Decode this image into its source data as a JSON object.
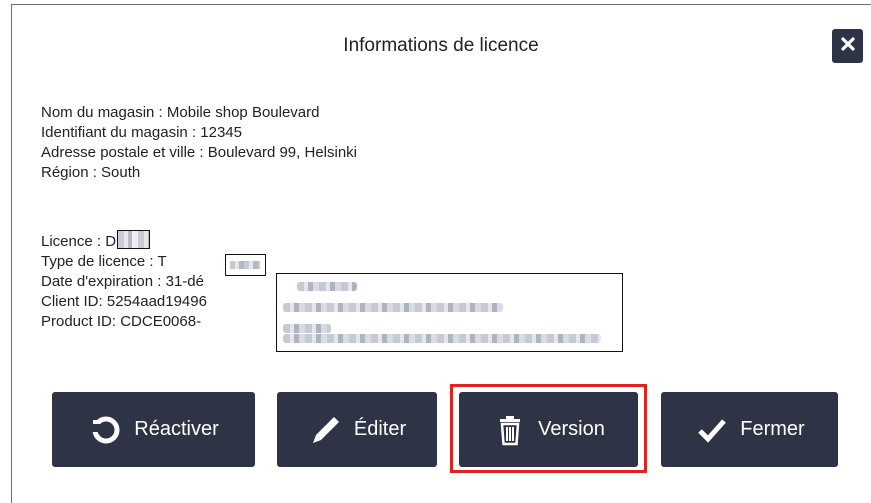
{
  "dialog": {
    "title": "Informations de licence",
    "close_icon": "close-icon"
  },
  "store": {
    "name_line": "Nom du magasin : Mobile shop Boulevard",
    "id_line": "Identifiant du magasin : 12345",
    "address_line": "Adresse postale et ville : Boulevard 99, Helsinki",
    "region_line": "Région : South"
  },
  "license": {
    "licence_line": "Licence : D",
    "type_line": "Type de licence : T",
    "expiration_line": "Date d'expiration : 31-dé",
    "client_id_line": "Client ID: 5254aad19496",
    "product_id_line": "Product ID: CDCE0068-"
  },
  "buttons": {
    "reactivate": {
      "label": "Réactiver",
      "icon": "refresh-icon"
    },
    "edit": {
      "label": "Éditer",
      "icon": "pencil-icon"
    },
    "version": {
      "label": "Version",
      "icon": "trash-icon"
    },
    "close": {
      "label": "Fermer",
      "icon": "checkmark-icon"
    }
  },
  "colors": {
    "button_bg": "#2e3446",
    "highlight": "#e22121"
  }
}
